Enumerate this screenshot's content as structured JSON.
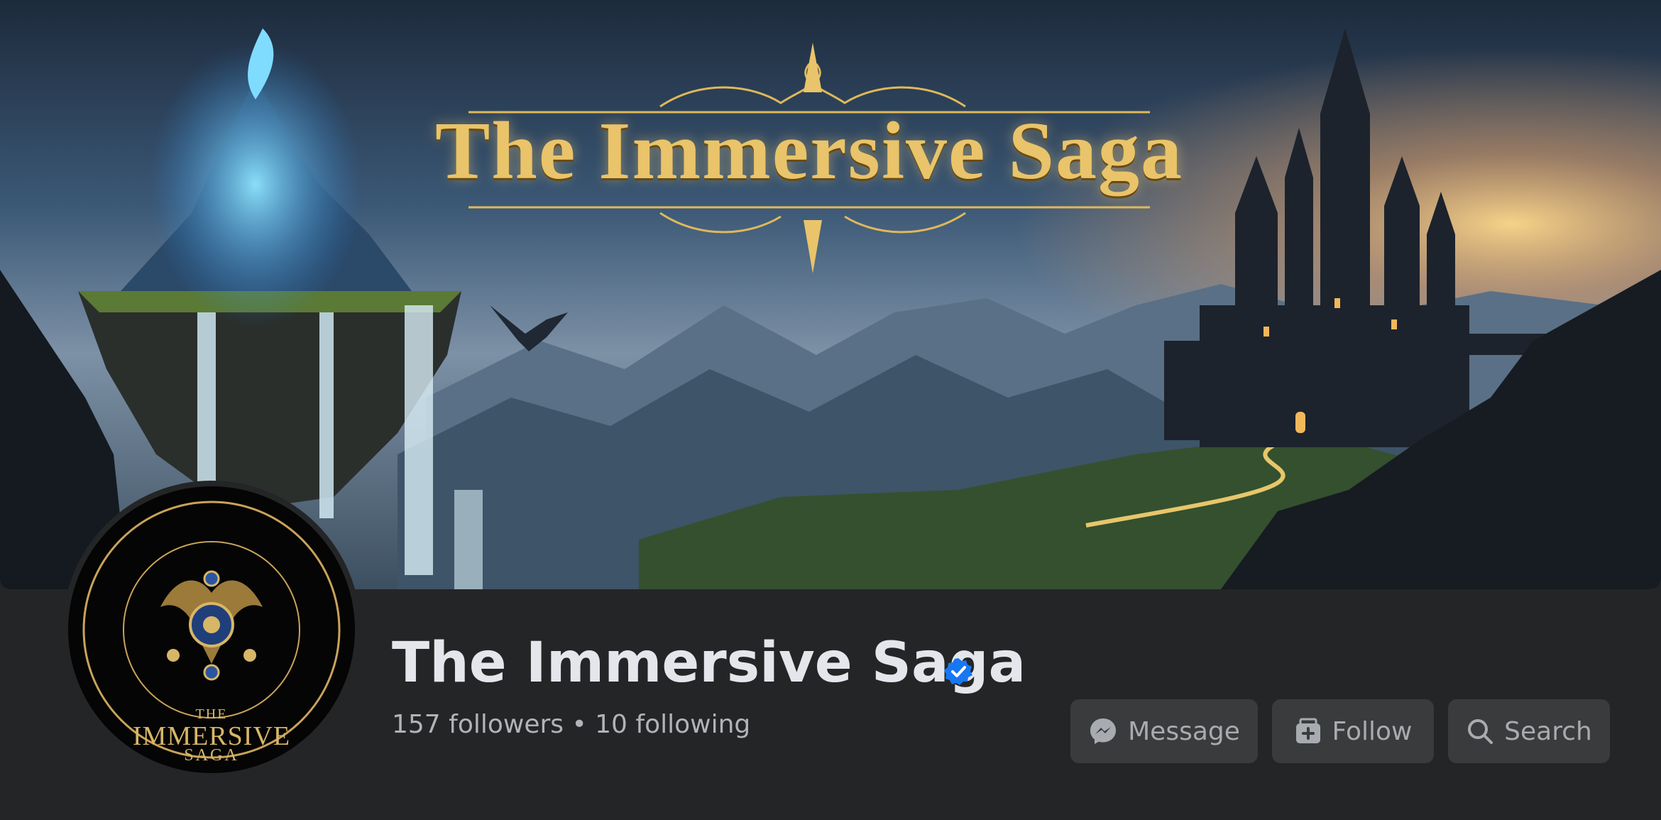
{
  "cover": {
    "title_text": "The Immersive Saga"
  },
  "avatar": {
    "line1": "THE",
    "line2": "IMMERSIVE",
    "line3": "SAGA"
  },
  "profile": {
    "name": "The Immersive Saga",
    "verified_icon": "verified-badge-icon",
    "stats": "157 followers • 10 following"
  },
  "actions": {
    "message_label": "Message",
    "follow_label": "Follow",
    "search_label": "Search"
  },
  "colors": {
    "background": "#242526",
    "button": "#3a3b3c",
    "verified": "#1877f2",
    "text_primary": "#e4e6eb",
    "text_secondary": "#b0b3b8"
  }
}
